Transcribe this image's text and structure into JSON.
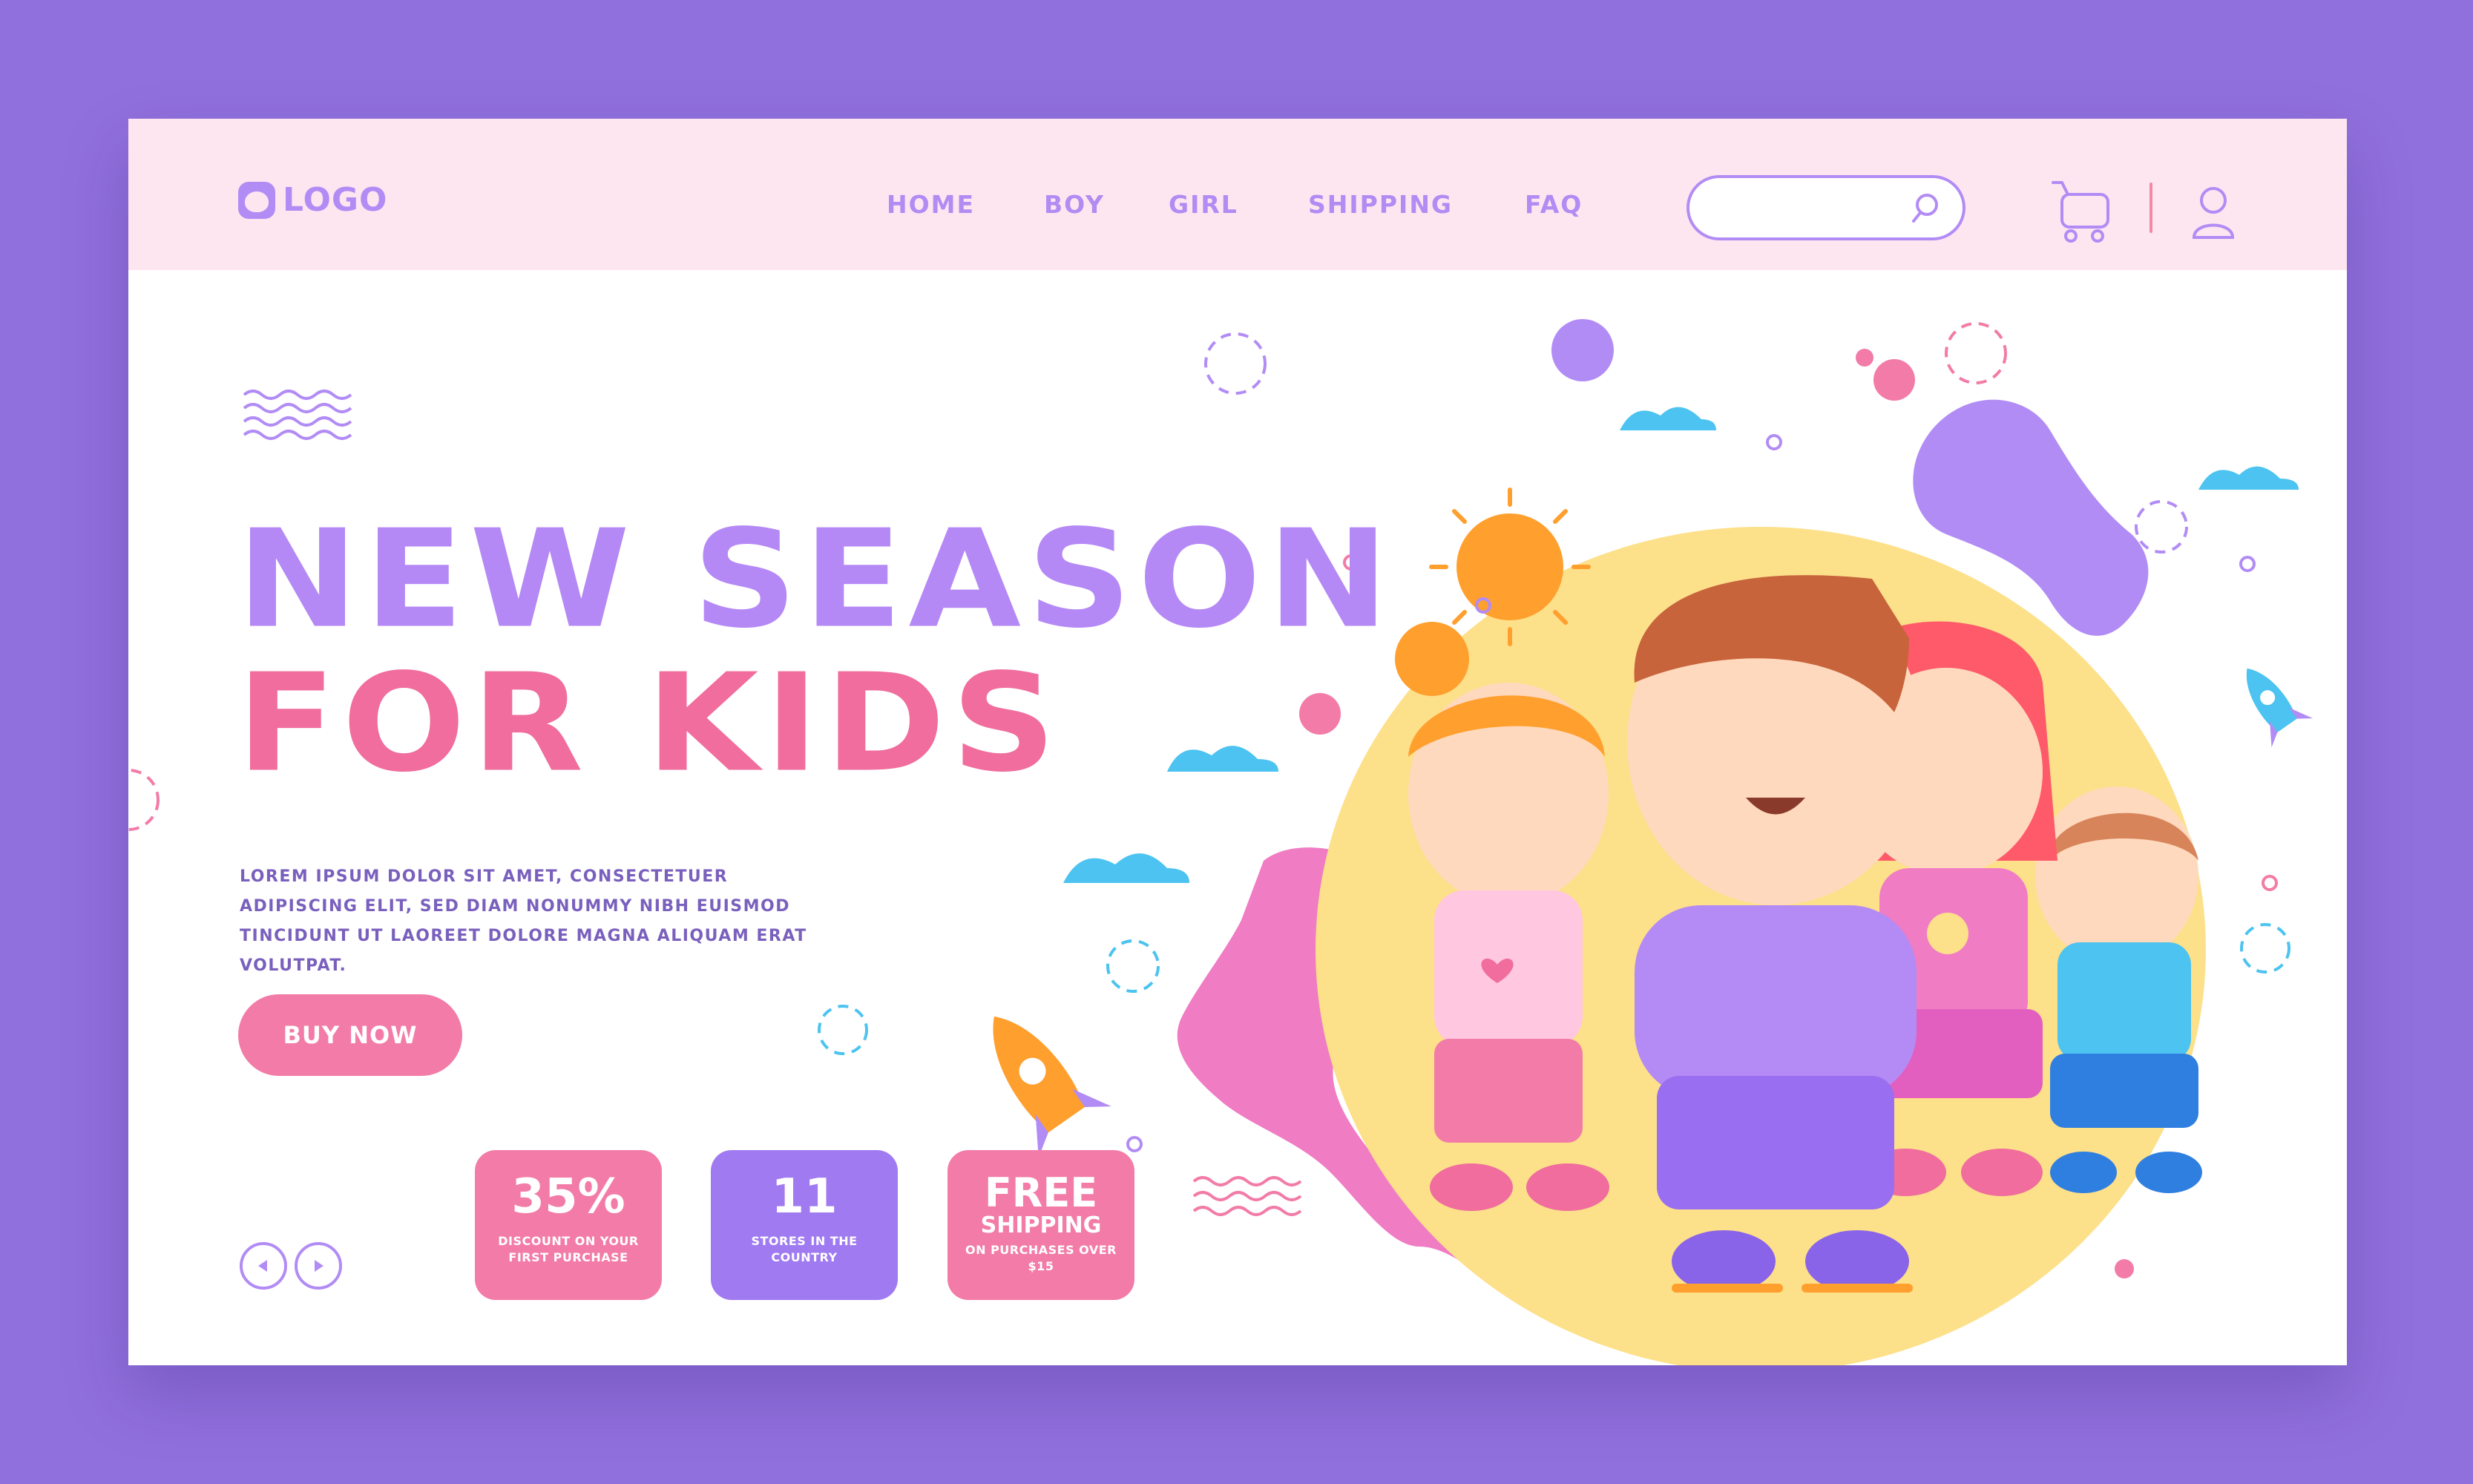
{
  "header": {
    "logo_text": "LOGO",
    "nav": [
      "HOME",
      "BOY",
      "GIRL",
      "SHIPPING",
      "FAQ"
    ],
    "search": {
      "placeholder": "",
      "value": ""
    },
    "icons": [
      "search-icon",
      "cart-icon",
      "user-icon"
    ]
  },
  "hero": {
    "title_line1": "NEW SEASON",
    "title_line2": "FOR KIDS",
    "description": "LOREM IPSUM DOLOR SIT AMET, CONSECTETUER ADIPISCING ELIT, SED DIAM NONUMMY NIBH EUISMOD TINCIDUNT UT LAOREET DOLORE MAGNA ALIQUAM ERAT VOLUTPAT.",
    "cta_label": "BUY NOW"
  },
  "stats": [
    {
      "value": "35%",
      "caption": "DISCOUNT ON YOUR FIRST PURCHASE"
    },
    {
      "value": "11",
      "caption": "STORES IN THE COUNTRY"
    },
    {
      "value": "FREE",
      "value2": "SHIPPING",
      "caption": "ON PURCHASES OVER $15"
    }
  ],
  "colors": {
    "background": "#9070dc",
    "header": "#fde6f0",
    "purple": "#b589f5",
    "pink": "#f06d9d",
    "violet_card": "#a07af0",
    "yellow": "#fde08a",
    "sky": "#4cc3f0"
  }
}
